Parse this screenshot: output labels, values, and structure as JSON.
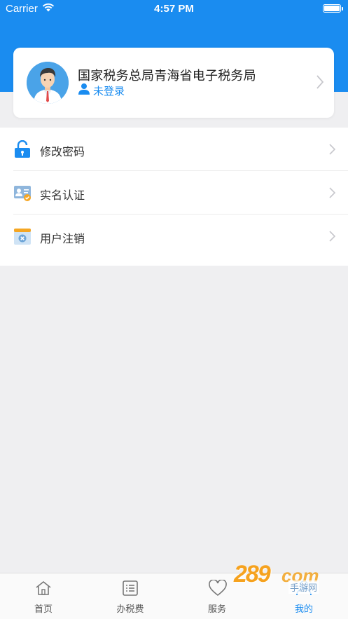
{
  "status_bar": {
    "carrier": "Carrier",
    "time": "4:57 PM",
    "battery_level": 1.0
  },
  "profile": {
    "org_name": "国家税务总局青海省电子税务局",
    "login_status": "未登录",
    "avatar_icon": "user-avatar-icon"
  },
  "menu": {
    "items": [
      {
        "label": "修改密码",
        "icon": "lock-icon"
      },
      {
        "label": "实名认证",
        "icon": "id-card-icon"
      },
      {
        "label": "用户注销",
        "icon": "cancel-account-icon"
      }
    ]
  },
  "tabbar": {
    "tabs": [
      {
        "label": "首页",
        "icon": "home-icon",
        "active": false
      },
      {
        "label": "办税费",
        "icon": "list-icon",
        "active": false
      },
      {
        "label": "服务",
        "icon": "heart-icon",
        "active": false
      },
      {
        "label": "我的",
        "icon": "user-icon",
        "active": true
      }
    ]
  },
  "watermark": {
    "brand": "289",
    "suffix": "com",
    "cn": "手游网"
  },
  "colors": {
    "primary": "#1a8cf0",
    "background": "#efeff1",
    "watermark_orange": "#f6a21e"
  }
}
